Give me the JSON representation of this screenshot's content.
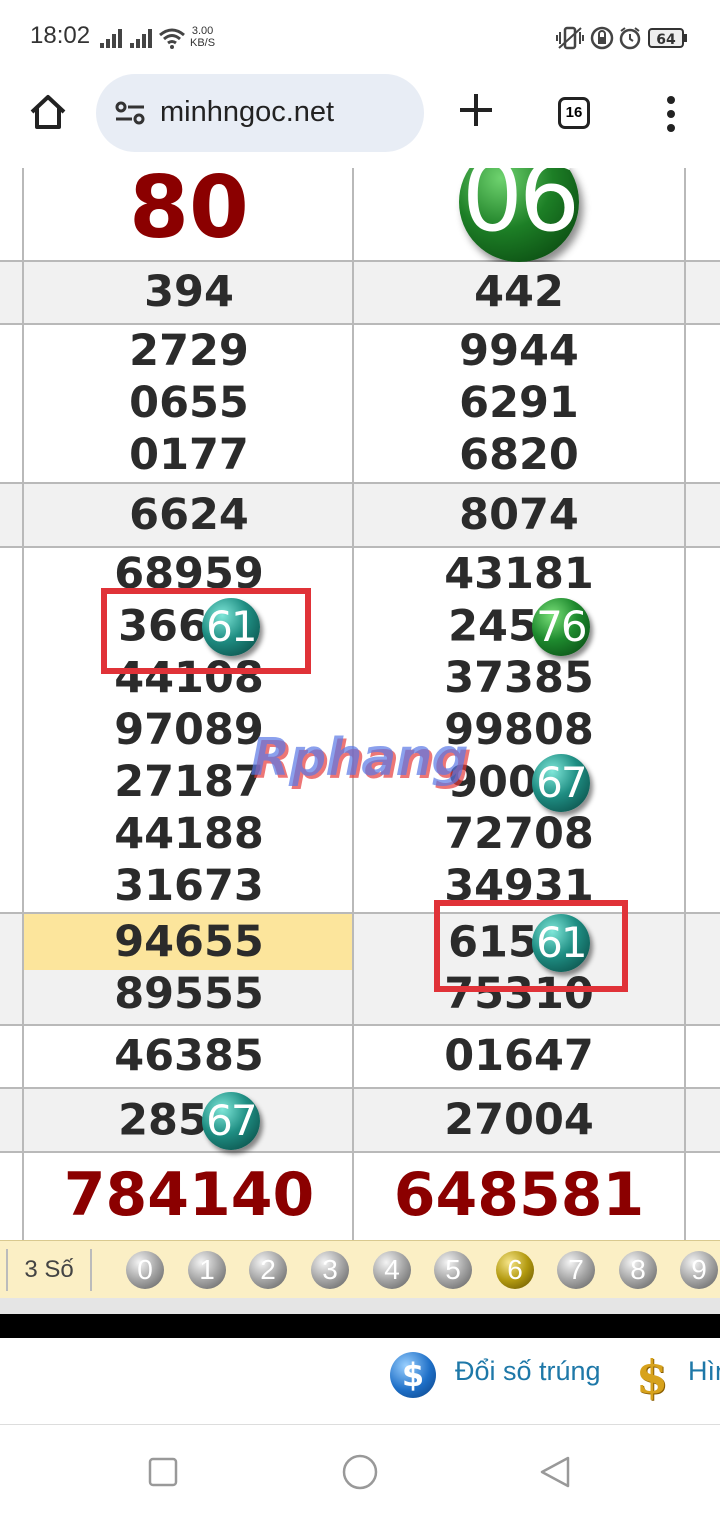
{
  "status_bar": {
    "time": "18:02",
    "net_speed_value": "3.00",
    "net_speed_unit": "KB/S",
    "battery": "64"
  },
  "browser": {
    "url": "minhngoc.net",
    "tab_count": "16"
  },
  "results": {
    "top": {
      "left": "80",
      "right": "06"
    },
    "row_a": {
      "left": "394",
      "right": "442"
    },
    "row_b": {
      "left": [
        "2729",
        "0655",
        "0177"
      ],
      "right": [
        "9944",
        "6291",
        "6820"
      ]
    },
    "row_c": {
      "left": "6624",
      "right": "8074"
    },
    "row_d": {
      "left": [
        "68959",
        "366",
        "44108",
        "97089",
        "27187",
        "44188",
        "31673"
      ],
      "left_ball": "61",
      "right": [
        "43181",
        "245",
        "37385",
        "99808",
        "900",
        "72708",
        "34931"
      ],
      "right_balls": [
        "76",
        "67"
      ]
    },
    "row_e": {
      "left": [
        "94655",
        "89555"
      ],
      "right": [
        "615",
        "75310"
      ],
      "right_ball": "61"
    },
    "row_f": {
      "left": "46385",
      "right": "01647"
    },
    "row_g": {
      "left": "285",
      "left_ball": "67",
      "right": "27004"
    },
    "special": {
      "left": "784140",
      "right": "648581"
    }
  },
  "watermark": "Rphang",
  "digit_bar": {
    "label": "3 Số",
    "digits": [
      "0",
      "1",
      "2",
      "3",
      "4",
      "5",
      "6",
      "7",
      "8",
      "9"
    ],
    "selected": "6"
  },
  "footer": {
    "link1": "Đổi số trúng",
    "link2": "Hìn"
  },
  "colors": {
    "highlight": "#fce59c",
    "special_red": "#8b0000",
    "mark_red": "#e03238",
    "url_bg": "#e8edf5"
  }
}
